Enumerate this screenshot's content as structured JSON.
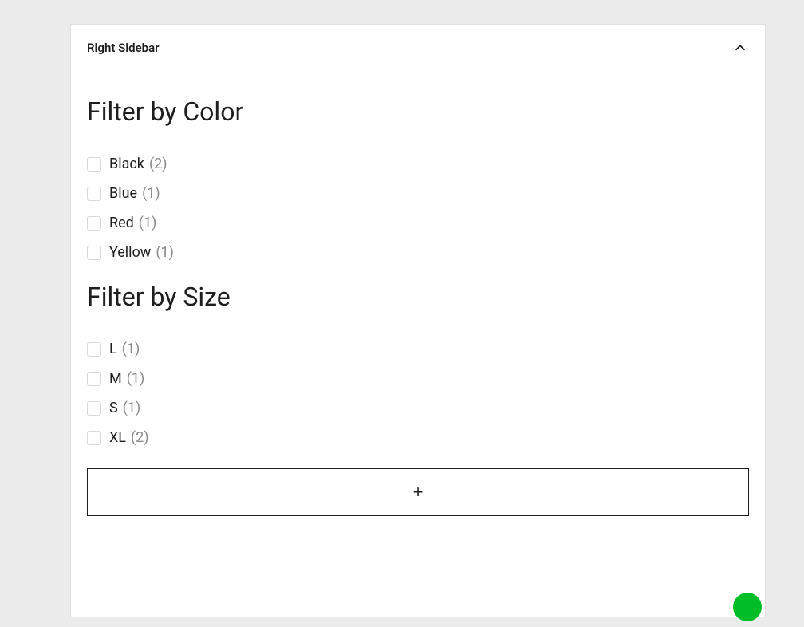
{
  "panel": {
    "title": "Right Sidebar"
  },
  "filters": {
    "color": {
      "heading": "Filter by Color",
      "items": [
        {
          "label": "Black",
          "count": "(2)"
        },
        {
          "label": "Blue",
          "count": "(1)"
        },
        {
          "label": "Red",
          "count": "(1)"
        },
        {
          "label": "Yellow",
          "count": "(1)"
        }
      ]
    },
    "size": {
      "heading": "Filter by Size",
      "items": [
        {
          "label": "L",
          "count": "(1)"
        },
        {
          "label": "M",
          "count": "(1)"
        },
        {
          "label": "S",
          "count": "(1)"
        },
        {
          "label": "XL",
          "count": "(2)"
        }
      ]
    }
  },
  "addBlock": {
    "label": "+"
  }
}
